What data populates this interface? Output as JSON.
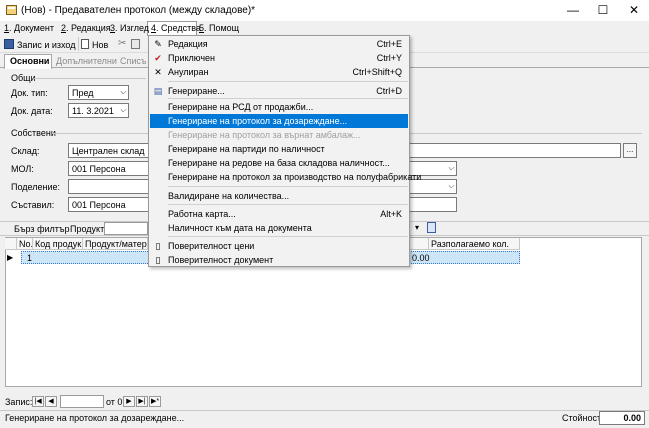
{
  "window": {
    "title": "(Нов) - Предавателен протокол (между складове)*"
  },
  "titlebar": {
    "minimize": "—",
    "maximize": "☐",
    "close": "✕"
  },
  "menubar": [
    {
      "key": "1",
      "label": ". Документ"
    },
    {
      "key": "2",
      "label": ". Редакция"
    },
    {
      "key": "3",
      "label": ". Изглед"
    },
    {
      "key": "4",
      "label": ". Средства"
    },
    {
      "key": "5",
      "label": ". Помощ"
    }
  ],
  "toolbar": {
    "save_exit": "Запис и изход",
    "new": "Нов"
  },
  "tabs": {
    "main": "Основни",
    "extra": "Допълнителни",
    "lists": "Списъ"
  },
  "general": {
    "header": "Общи",
    "doc_type_label": "Док. тип:",
    "doc_type_value": "Пред",
    "doc_date_label": "Док. дата:",
    "doc_date_value": "11.  3.2021"
  },
  "own": {
    "header": "Собствени",
    "warehouse_label": "Склад:",
    "warehouse_value": "Централен склад",
    "mol_label": "МОЛ:",
    "mol_value": "001 Персона",
    "division_label": "Поделение:",
    "division_value": "",
    "author_label": "Съставил:",
    "author_value": "001 Персона",
    "ellipsis": "..."
  },
  "filter": {
    "quick": "Бърз филтър",
    "product": "Продукт:"
  },
  "grid": {
    "columns": [
      "No.",
      "Код продук...",
      "Продукт/материа",
      "Разполагаемо кол."
    ],
    "rows": [
      {
        "no": "1",
        "available": "0.00"
      }
    ]
  },
  "nav": {
    "record_label": "Запис:",
    "of_label": "от 0",
    "first": "|◀",
    "prev": "◀",
    "next": "▶",
    "last": "▶|",
    "new": "▶*"
  },
  "status": {
    "text": "Генериране на протокол за дозареждане...",
    "value_label": "Стойност:",
    "value": "0.00"
  },
  "menu_tools": {
    "items": [
      {
        "label": "Редакция",
        "shortcut": "Ctrl+E",
        "icon": "edit-icon",
        "glyph": "✎"
      },
      {
        "label": "Приключен",
        "shortcut": "Ctrl+Y",
        "icon": "checkmark-icon",
        "glyph": "✔"
      },
      {
        "label": "Анулиран",
        "shortcut": "Ctrl+Shift+Q",
        "icon": "cross-icon",
        "glyph": "✕"
      },
      {
        "label": "Генериране...",
        "shortcut": "Ctrl+D",
        "icon": "generate-icon",
        "glyph": "▤"
      },
      {
        "label": "Генериране на РСД от продажби...",
        "shortcut": ""
      },
      {
        "label": "Генериране на протокол за дозареждане...",
        "shortcut": "",
        "highlighted": true
      },
      {
        "label": "Генериране на протокол за върнат амбалаж...",
        "shortcut": "",
        "disabled": true
      },
      {
        "label": "Генериране на партиди по наличност",
        "shortcut": ""
      },
      {
        "label": "Генериране на редове на база складова наличност...",
        "shortcut": ""
      },
      {
        "label": "Генериране на протокол за производство на полуфабрикати",
        "shortcut": ""
      },
      {
        "label": "Валидиране на количества...",
        "shortcut": ""
      },
      {
        "label": "Работна карта...",
        "shortcut": "Alt+K"
      },
      {
        "label": "Наличност към дата на документа",
        "shortcut": ""
      },
      {
        "label": "Поверителност цени",
        "shortcut": "",
        "icon": "page-icon",
        "glyph": "▯"
      },
      {
        "label": "Поверителност документ",
        "shortcut": "",
        "icon": "page-icon",
        "glyph": "▯"
      }
    ]
  },
  "colors": {
    "highlight": "#0078d7",
    "row_selected": "#cde6f7",
    "check_red": "#c81e1e"
  }
}
